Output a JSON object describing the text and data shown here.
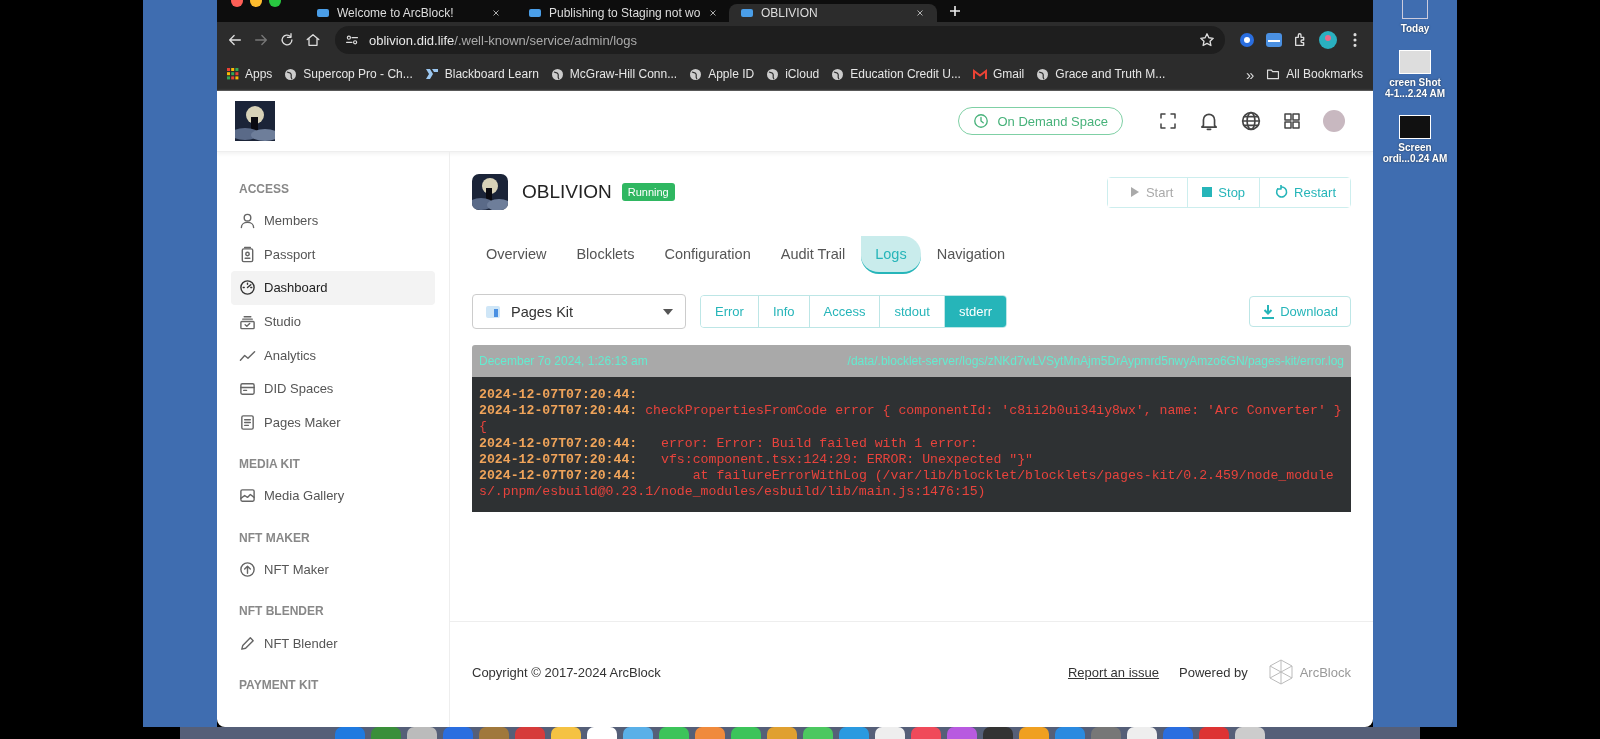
{
  "browser": {
    "tabs": [
      {
        "title": "Welcome to ArcBlock!",
        "selected": false
      },
      {
        "title": "Publishing to Staging not wo",
        "selected": false
      },
      {
        "title": "OBLIVION",
        "selected": true
      }
    ],
    "address": {
      "host": "oblivion.did.life",
      "path": "/.well-known/service/admin/logs"
    },
    "bookmarks": [
      {
        "label": "Apps",
        "kind": "apps"
      },
      {
        "label": "Supercop Pro - Ch...",
        "kind": "site"
      },
      {
        "label": "Blackboard Learn",
        "kind": "blackboard"
      },
      {
        "label": "McGraw-Hill Conn...",
        "kind": "site"
      },
      {
        "label": "Apple ID",
        "kind": "site"
      },
      {
        "label": "iCloud",
        "kind": "site"
      },
      {
        "label": "Education Credit U...",
        "kind": "site"
      },
      {
        "label": "Gmail",
        "kind": "gmail"
      },
      {
        "label": "Grace and Truth M...",
        "kind": "site"
      }
    ],
    "bookmarks_overflow": "»",
    "all_bookmarks": "All Bookmarks"
  },
  "header": {
    "space_button": "On Demand Space"
  },
  "sidebar": {
    "sections": [
      {
        "title": "ACCESS",
        "items": [
          {
            "label": "Members",
            "selected": false
          },
          {
            "label": "Passport",
            "selected": false
          },
          {
            "label": "Dashboard",
            "selected": true
          },
          {
            "label": "Studio",
            "selected": false
          },
          {
            "label": "Analytics",
            "selected": false
          },
          {
            "label": "DID Spaces",
            "selected": false
          },
          {
            "label": "Pages Maker",
            "selected": false
          }
        ]
      },
      {
        "title": "MEDIA KIT",
        "items": [
          {
            "label": "Media Gallery",
            "selected": false
          }
        ]
      },
      {
        "title": "NFT MAKER",
        "items": [
          {
            "label": "NFT Maker",
            "selected": false
          }
        ]
      },
      {
        "title": "NFT BLENDER",
        "items": [
          {
            "label": "NFT Blender",
            "selected": false
          }
        ]
      },
      {
        "title": "PAYMENT KIT"
      }
    ]
  },
  "app": {
    "name": "OBLIVION",
    "status": "Running",
    "actions": [
      {
        "label": "Start",
        "kind": "start",
        "disabled": true
      },
      {
        "label": "Stop",
        "kind": "stop",
        "disabled": false
      },
      {
        "label": "Restart",
        "kind": "restart",
        "disabled": false
      }
    ],
    "tabs": [
      {
        "label": "Overview",
        "selected": false
      },
      {
        "label": "Blocklets",
        "selected": false
      },
      {
        "label": "Configuration",
        "selected": false
      },
      {
        "label": "Audit Trail",
        "selected": false
      },
      {
        "label": "Logs",
        "selected": true
      },
      {
        "label": "Navigation",
        "selected": false
      }
    ],
    "component_select": "Pages Kit",
    "log_types": [
      {
        "label": "Error",
        "selected": false
      },
      {
        "label": "Info",
        "selected": false
      },
      {
        "label": "Access",
        "selected": false
      },
      {
        "label": "stdout",
        "selected": false
      },
      {
        "label": "stderr",
        "selected": true
      }
    ],
    "download": "Download"
  },
  "log": {
    "time": "December 7o 2024, 1:26:13 am",
    "path": "/data/.blocklet-server/logs/zNKd7wLVSytMnAjm5DrAypmrd5nwyAmzo6GN/pages-kit/error.log",
    "lines": [
      {
        "time": "2024-12-07T07:20:44:"
      },
      {
        "time": "2024-12-07T07:20:44:",
        "message": "checkPropertiesFromCode error { componentId: 'c8ii2b0ui34iy8wx', name: 'Arc Converter' } {"
      },
      {
        "time": "2024-12-07T07:20:44:",
        "message": "  error: Error: Build failed with 1 error:"
      },
      {
        "time": "2024-12-07T07:20:44:",
        "message": "  vfs:component.tsx:124:29: ERROR: Unexpected \"}\""
      },
      {
        "time": "2024-12-07T07:20:44:",
        "message": "      at failureErrorWithLog (/var/lib/blocklet/blocklets/pages-kit/0.2.459/node_modules/.pnpm/esbuild@0.23.1/node_modules/esbuild/lib/main.js:1476:15)"
      }
    ]
  },
  "footer": {
    "copyright": "Copyright © 2017-2024  ArcBlock",
    "report": "Report an issue",
    "powered_by": "Powered by",
    "brand": "ArcBlock"
  },
  "desktop": {
    "items": [
      {
        "label": "Today",
        "kind": "folder"
      },
      {
        "label": "creen Shot",
        "label_2": "4-1...2.24 AM",
        "kind": "screenshot"
      },
      {
        "label": "Screen",
        "label_2": "ordi...0.24 AM",
        "kind": "recording"
      }
    ]
  }
}
